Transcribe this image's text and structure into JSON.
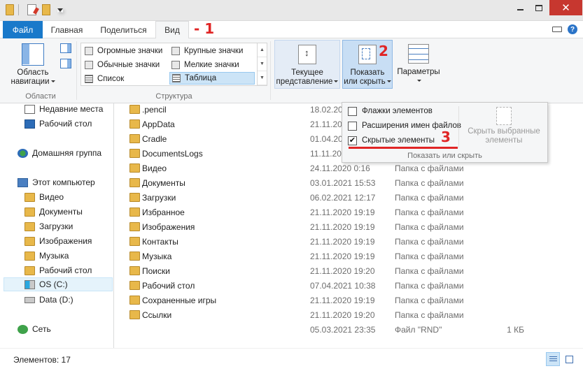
{
  "window": {
    "close_glyph": "✕",
    "minimize_glyph": "",
    "maximize_glyph": ""
  },
  "tabs": {
    "file": "Файл",
    "home": "Главная",
    "share": "Поделиться",
    "view": "Вид"
  },
  "annotations": {
    "one": "- 1",
    "two": "2",
    "three": "3"
  },
  "ribbon": {
    "nav_pane_label_1": "Область",
    "nav_pane_label_2": "навигации",
    "group_areas": "Области",
    "group_layout": "Структура",
    "layout_items": [
      "Огромные значки",
      "Крупные значки",
      "Обычные значки",
      "Мелкие значки",
      "Список",
      "Таблица"
    ],
    "current_view_1": "Текущее",
    "current_view_2": "представление",
    "show_hide_1": "Показать",
    "show_hide_2": "или скрыть",
    "options": "Параметры"
  },
  "showhide_panel": {
    "item_checkboxes": "Флажки элементов",
    "file_extensions": "Расширения имен файлов",
    "hidden_items": "Скрытые элементы",
    "hidden_items_checked": true,
    "hide_selected_1": "Скрыть выбранные",
    "hide_selected_2": "элементы",
    "group_label": "Показать или скрыть"
  },
  "sidebar": {
    "recent_places": "Недавние места",
    "desktop": "Рабочий стол",
    "homegroup": "Домашняя группа",
    "this_pc": "Этот компьютер",
    "pc_items": [
      "Видео",
      "Документы",
      "Загрузки",
      "Изображения",
      "Музыка",
      "Рабочий стол",
      "OS (C:)",
      "Data (D:)"
    ],
    "network": "Сеть"
  },
  "files": [
    {
      "name": ".pencil",
      "date": "18.02.2021",
      "type": "",
      "size": ""
    },
    {
      "name": "AppData",
      "date": "21.11.2020",
      "type": "",
      "size": ""
    },
    {
      "name": "Cradle",
      "date": "01.04.2021",
      "type": "",
      "size": ""
    },
    {
      "name": "DocumentsLogs",
      "date": "11.11.2021",
      "type": "",
      "size": ""
    },
    {
      "name": "Видео",
      "date": "24.11.2020 0:16",
      "type": "Папка с файлами",
      "size": ""
    },
    {
      "name": "Документы",
      "date": "03.01.2021 15:53",
      "type": "Папка с файлами",
      "size": ""
    },
    {
      "name": "Загрузки",
      "date": "06.02.2021 12:17",
      "type": "Папка с файлами",
      "size": ""
    },
    {
      "name": "Избранное",
      "date": "21.11.2020 19:19",
      "type": "Папка с файлами",
      "size": ""
    },
    {
      "name": "Изображения",
      "date": "21.11.2020 19:19",
      "type": "Папка с файлами",
      "size": ""
    },
    {
      "name": "Контакты",
      "date": "21.11.2020 19:19",
      "type": "Папка с файлами",
      "size": ""
    },
    {
      "name": "Музыка",
      "date": "21.11.2020 19:19",
      "type": "Папка с файлами",
      "size": ""
    },
    {
      "name": "Поиски",
      "date": "21.11.2020 19:20",
      "type": "Папка с файлами",
      "size": ""
    },
    {
      "name": "Рабочий стол",
      "date": "07.04.2021 10:38",
      "type": "Папка с файлами",
      "size": ""
    },
    {
      "name": "Сохраненные игры",
      "date": "21.11.2020 19:19",
      "type": "Папка с файлами",
      "size": ""
    },
    {
      "name": "Ссылки",
      "date": "21.11.2020 19:20",
      "type": "Папка с файлами",
      "size": ""
    },
    {
      "name": "",
      "date": "05.03.2021 23:35",
      "type": "Файл \"RND\"",
      "size": "1 КБ"
    }
  ],
  "status": {
    "items_count": "Элементов: 17"
  },
  "colors": {
    "accent": "#1979ca",
    "annotation_red": "#e02525",
    "close_red": "#c7372f",
    "selection": "#cce4f7"
  }
}
